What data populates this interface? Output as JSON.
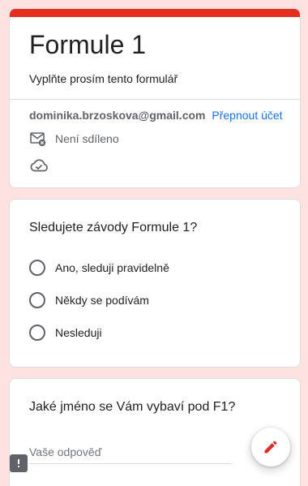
{
  "form": {
    "title": "Formule 1",
    "description": "Vyplňte prosím tento formulář",
    "accent_color": "#e52e1e",
    "background_color": "#fde2e0"
  },
  "account": {
    "email": "dominika.brzoskova@gmail.com",
    "switch_label": "Přepnout účet",
    "share_status": "Není sdíleno",
    "share_icon": "mail-not-shared-icon",
    "cloud_icon": "cloud-saved-icon"
  },
  "question1": {
    "text": "Sledujete závody Formule 1?",
    "options": [
      {
        "label": "Ano, sleduji pravidelně"
      },
      {
        "label": "Někdy se podívám"
      },
      {
        "label": "Nesleduji"
      }
    ]
  },
  "question2": {
    "text": "Jaké jméno se Vám vybaví pod F1?",
    "placeholder": "Vaše odpověď",
    "value": ""
  },
  "actions": {
    "edit_icon": "pencil-icon",
    "feedback_icon": "report-problem-icon"
  }
}
